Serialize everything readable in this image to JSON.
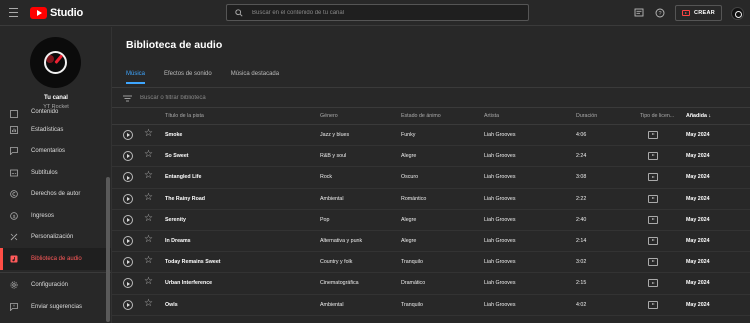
{
  "header": {
    "logo_text": "Studio",
    "search_placeholder": "Buscar en el contenido de tu canal",
    "create_label": "CREAR"
  },
  "sidebar": {
    "channel_name": "Tu canal",
    "channel_subtitle": "YT Rocket",
    "items": [
      {
        "label": "Contenido",
        "icon": "content-icon"
      },
      {
        "label": "Estadísticas",
        "icon": "analytics-icon"
      },
      {
        "label": "Comentarios",
        "icon": "comments-icon"
      },
      {
        "label": "Subtítulos",
        "icon": "subtitles-icon"
      },
      {
        "label": "Derechos de autor",
        "icon": "copyright-icon"
      },
      {
        "label": "Ingresos",
        "icon": "earn-icon"
      },
      {
        "label": "Personalización",
        "icon": "customization-icon"
      },
      {
        "label": "Biblioteca de audio",
        "icon": "audio-library-icon"
      }
    ],
    "bottom_items": [
      {
        "label": "Configuración",
        "icon": "gear-icon"
      },
      {
        "label": "Enviar sugerencias",
        "icon": "feedback-icon"
      }
    ]
  },
  "main": {
    "title": "Biblioteca de audio",
    "tabs": [
      {
        "label": "Música"
      },
      {
        "label": "Efectos de sonido"
      },
      {
        "label": "Música destacada"
      }
    ],
    "filter_placeholder": "Buscar o filtrar biblioteca",
    "columns": {
      "title": "Título de la pista",
      "genre": "Género",
      "mood": "Estado de ánimo",
      "artist": "Artista",
      "duration": "Duración",
      "license": "Tipo de licen...",
      "added": "Añadida ↓"
    },
    "rows": [
      {
        "title": "Smoke",
        "genre": "Jazz y blues",
        "mood": "Funky",
        "artist": "Liah Grooves",
        "duration": "4:06",
        "added": "May 2024"
      },
      {
        "title": "So Sweet",
        "genre": "R&B y soul",
        "mood": "Alegre",
        "artist": "Liah Grooves",
        "duration": "2:24",
        "added": "May 2024"
      },
      {
        "title": "Entangled Life",
        "genre": "Rock",
        "mood": "Oscuro",
        "artist": "Liah Grooves",
        "duration": "3:08",
        "added": "May 2024"
      },
      {
        "title": "The Rainy Road",
        "genre": "Ambiental",
        "mood": "Romántico",
        "artist": "Liah Grooves",
        "duration": "2:22",
        "added": "May 2024"
      },
      {
        "title": "Serenity",
        "genre": "Pop",
        "mood": "Alegre",
        "artist": "Liah Grooves",
        "duration": "2:40",
        "added": "May 2024"
      },
      {
        "title": "In Dreams",
        "genre": "Alternativa y punk",
        "mood": "Alegre",
        "artist": "Liah Grooves",
        "duration": "2:14",
        "added": "May 2024"
      },
      {
        "title": "Today Remains Sweet",
        "genre": "Country y folk",
        "mood": "Tranquilo",
        "artist": "Liah Grooves",
        "duration": "3:02",
        "added": "May 2024"
      },
      {
        "title": "Urban Interference",
        "genre": "Cinematográfica",
        "mood": "Dramático",
        "artist": "Liah Grooves",
        "duration": "2:15",
        "added": "May 2024"
      },
      {
        "title": "Owls",
        "genre": "Ambiental",
        "mood": "Tranquilo",
        "artist": "Liah Grooves",
        "duration": "4:02",
        "added": "May 2024"
      }
    ]
  },
  "colors": {
    "accent": "#3ea6ff",
    "brand": "#ff0000",
    "active_nav": "#ff5a5a"
  }
}
